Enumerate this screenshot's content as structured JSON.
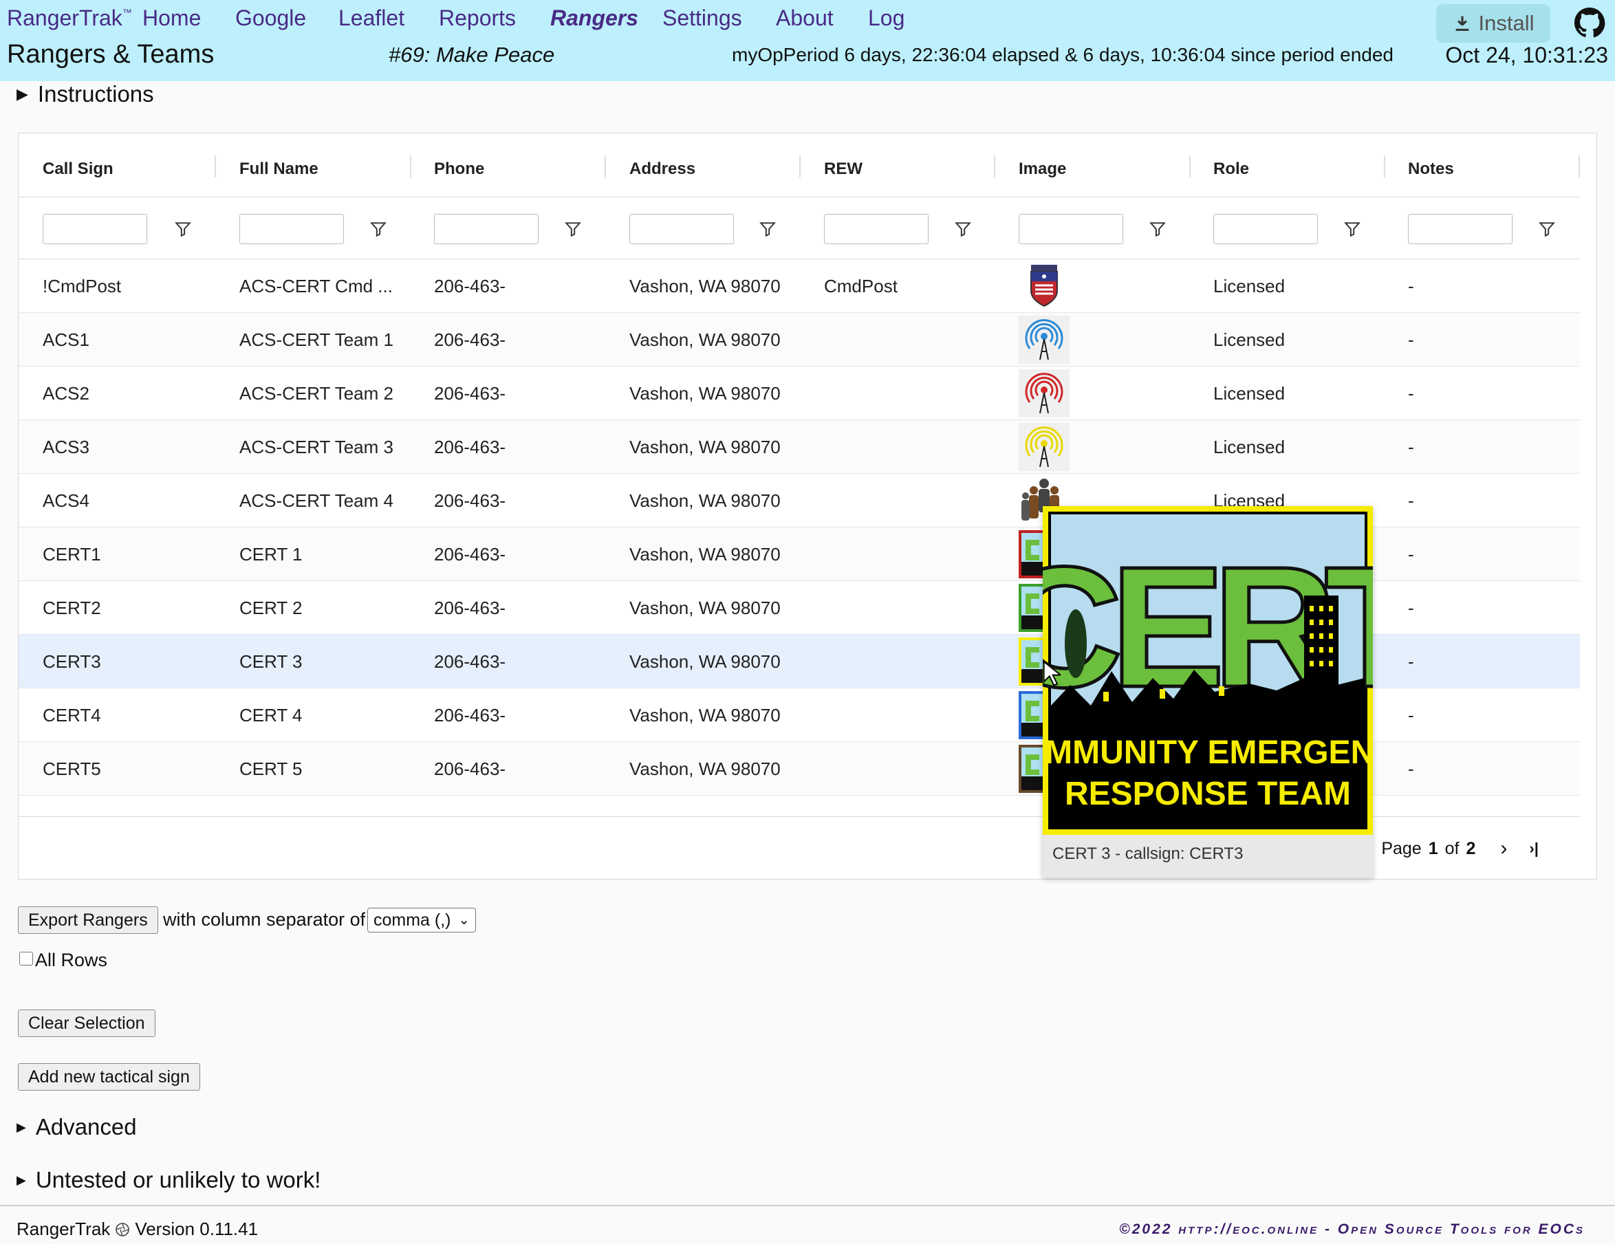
{
  "header": {
    "brand": "RangerTrak",
    "brand_tm": "™",
    "nav": [
      "Home",
      "Google",
      "Leaflet",
      "Reports",
      "Rangers",
      "Settings",
      "About",
      "Log"
    ],
    "active_nav": "Rangers",
    "page_title": "Rangers & Teams",
    "incident": "#69: Make Peace",
    "period": "myOpPeriod 6 days, 22:36:04 elapsed & 6 days, 10:36:04 since period ended",
    "clock": "Oct 24, 10:31:23",
    "install_label": "Install",
    "github_icon": "github-icon"
  },
  "instructions_label": "Instructions",
  "grid": {
    "columns": [
      "Call Sign",
      "Full Name",
      "Phone",
      "Address",
      "REW",
      "Image",
      "Role",
      "Notes"
    ],
    "rows": [
      {
        "call_sign": "!CmdPost",
        "full_name": "ACS-CERT Cmd ...",
        "phone": "206-463-",
        "address": "Vashon, WA 98070",
        "rew": "CmdPost",
        "image": "command-post-badge",
        "role": "Licensed",
        "notes": "-"
      },
      {
        "call_sign": "ACS1",
        "full_name": "ACS-CERT Team 1",
        "phone": "206-463-",
        "address": "Vashon, WA 98070",
        "rew": "",
        "image": "radio-tower-blue",
        "role": "Licensed",
        "notes": "-"
      },
      {
        "call_sign": "ACS2",
        "full_name": "ACS-CERT Team 2",
        "phone": "206-463-",
        "address": "Vashon, WA 98070",
        "rew": "",
        "image": "radio-tower-red",
        "role": "Licensed",
        "notes": "-"
      },
      {
        "call_sign": "ACS3",
        "full_name": "ACS-CERT Team 3",
        "phone": "206-463-",
        "address": "Vashon, WA 98070",
        "rew": "",
        "image": "radio-tower-yellow",
        "role": "Licensed",
        "notes": "-"
      },
      {
        "call_sign": "ACS4",
        "full_name": "ACS-CERT Team 4",
        "phone": "206-463-",
        "address": "Vashon, WA 98070",
        "rew": "",
        "image": "team-people",
        "role": "Licensed",
        "notes": "-"
      },
      {
        "call_sign": "CERT1",
        "full_name": "CERT 1",
        "phone": "206-463-",
        "address": "Vashon, WA 98070",
        "rew": "",
        "image": "cert-logo-red",
        "role": "",
        "notes": "-"
      },
      {
        "call_sign": "CERT2",
        "full_name": "CERT 2",
        "phone": "206-463-",
        "address": "Vashon, WA 98070",
        "rew": "",
        "image": "cert-logo-green",
        "role": "",
        "notes": "-"
      },
      {
        "call_sign": "CERT3",
        "full_name": "CERT 3",
        "phone": "206-463-",
        "address": "Vashon, WA 98070",
        "rew": "",
        "image": "cert-logo-yellow",
        "role": "",
        "notes": "-"
      },
      {
        "call_sign": "CERT4",
        "full_name": "CERT 4",
        "phone": "206-463-",
        "address": "Vashon, WA 98070",
        "rew": "",
        "image": "cert-logo-blue",
        "role": "",
        "notes": "-"
      },
      {
        "call_sign": "CERT5",
        "full_name": "CERT 5",
        "phone": "206-463-",
        "address": "Vashon, WA 98070",
        "rew": "",
        "image": "cert-logo-brown",
        "role": "",
        "notes": "-"
      }
    ],
    "selected_row": "CERT3",
    "pager": {
      "page_label": "Page",
      "current": "1",
      "of_label": "of",
      "total": "2"
    }
  },
  "popup": {
    "logo_line1": "COMMUNITY EMERGENCY",
    "logo_line2": "RESPONSE TEAM",
    "logo_big": "CERT",
    "caption": "CERT 3 - callsign: CERT3"
  },
  "export": {
    "button": "Export Rangers",
    "separator_label": "with column separator of",
    "separator_value": "comma (,)",
    "all_rows_label": "All Rows"
  },
  "buttons": {
    "clear_selection": "Clear Selection",
    "add_tactical": "Add new tactical sign"
  },
  "sections": {
    "advanced": "Advanced",
    "untested": "Untested or unlikely to work!"
  },
  "footer": {
    "app": "RangerTrak",
    "version": "Version 0.11.41",
    "copyright": "©2022 http://eoc.online - Open Source Tools for EOCs"
  },
  "colors": {
    "header_bg": "#bdf0fc",
    "nav_text": "#4a2a86",
    "selected_row": "#e6effc",
    "cert_green": "#6cbf3c",
    "cert_yellow": "#f6ec00"
  }
}
